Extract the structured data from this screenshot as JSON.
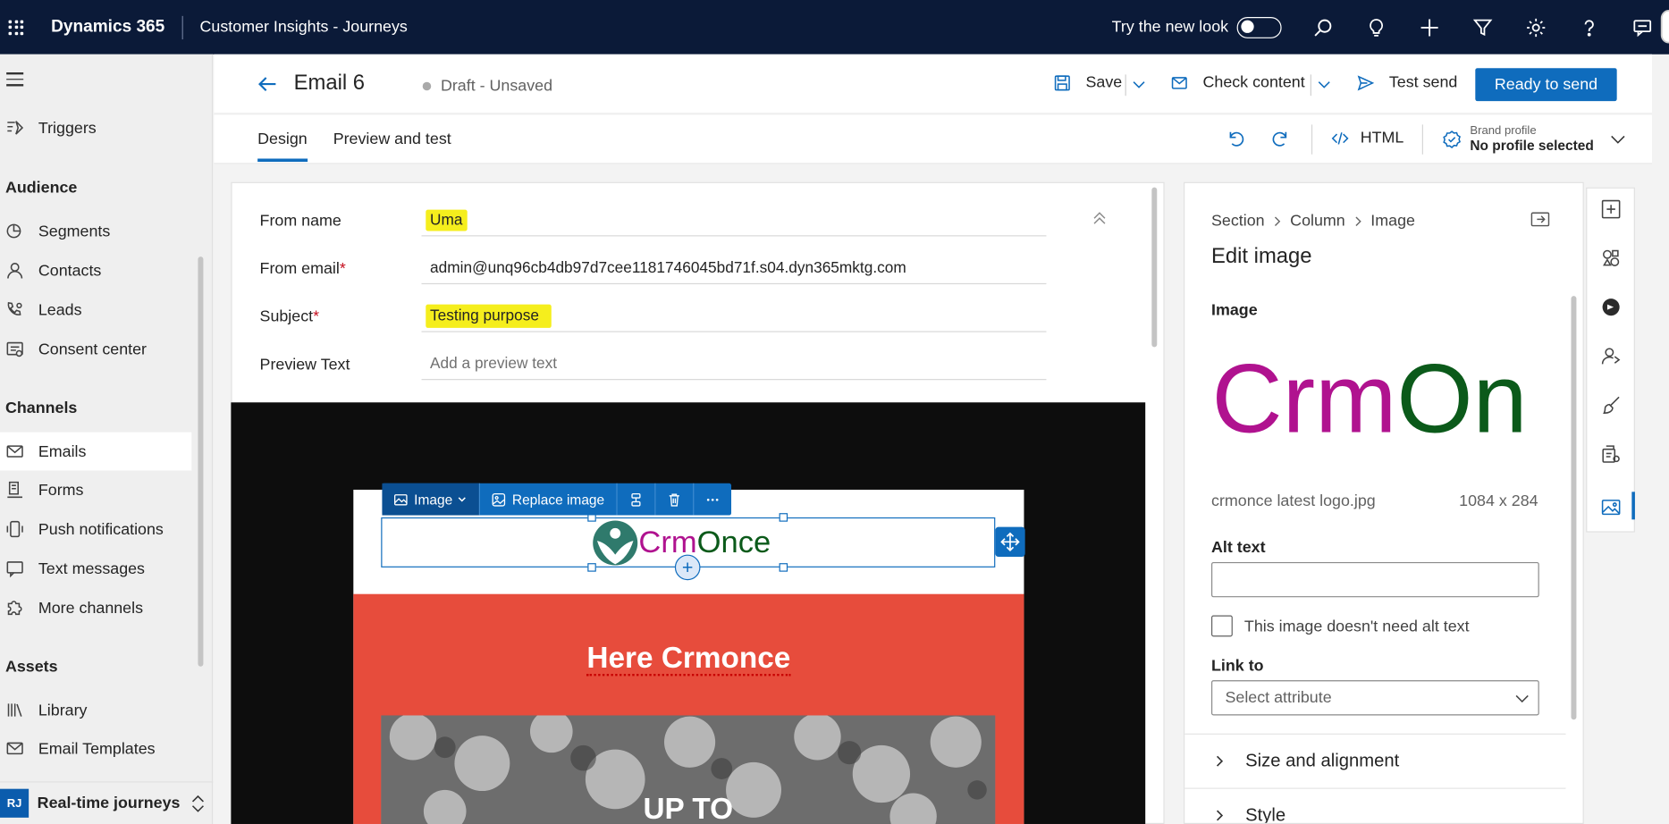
{
  "topbar": {
    "brand": "Dynamics 365",
    "app_name": "Customer Insights - Journeys",
    "try_new_look": "Try the new look",
    "icons": [
      "search-icon",
      "lightbulb-icon",
      "plus-icon",
      "filter-icon",
      "gear-icon",
      "help-icon",
      "chat-icon"
    ]
  },
  "nav": {
    "items_top": [
      {
        "label": "Triggers",
        "icon": "trigger-icon"
      }
    ],
    "audience_header": "Audience",
    "audience": [
      {
        "label": "Segments",
        "icon": "segments-icon"
      },
      {
        "label": "Contacts",
        "icon": "person-icon"
      },
      {
        "label": "Leads",
        "icon": "phone-person-icon"
      },
      {
        "label": "Consent center",
        "icon": "consent-icon"
      }
    ],
    "channels_header": "Channels",
    "channels": [
      {
        "label": "Emails",
        "icon": "mail-icon",
        "selected": true
      },
      {
        "label": "Forms",
        "icon": "form-icon"
      },
      {
        "label": "Push notifications",
        "icon": "push-icon"
      },
      {
        "label": "Text messages",
        "icon": "sms-icon"
      },
      {
        "label": "More channels",
        "icon": "puzzle-icon"
      }
    ],
    "assets_header": "Assets",
    "assets": [
      {
        "label": "Library",
        "icon": "library-icon"
      },
      {
        "label": "Email Templates",
        "icon": "template-icon"
      }
    ],
    "area_badge": "RJ",
    "area_label": "Real-time journeys"
  },
  "command": {
    "title": "Email 6",
    "status": "Draft - Unsaved",
    "save": "Save",
    "check_content": "Check content",
    "test_send": "Test send",
    "ready": "Ready to send"
  },
  "tabs": {
    "design": "Design",
    "preview": "Preview and test",
    "html": "HTML",
    "brand_profile_label": "Brand profile",
    "brand_profile_value": "No profile selected"
  },
  "form": {
    "from_name_label": "From name",
    "from_name": "Uma",
    "from_email_label": "From email",
    "from_email": "admin@unq96cb4db97d7cee1181746045bd71f.s04.dyn365mktg.com",
    "subject_label": "Subject",
    "subject": "Testing purpose",
    "preview_label": "Preview Text",
    "preview_placeholder": "Add a preview text",
    "required_mark": "*"
  },
  "canvas": {
    "toolbar_image": "Image",
    "toolbar_replace": "Replace image",
    "logo_part1": "Crm",
    "logo_part2": "Once",
    "hero_title": "Here Crmonce",
    "hero_image_text": "UP TO"
  },
  "panel": {
    "crumb": [
      "Section",
      "Column",
      "Image"
    ],
    "title": "Edit image",
    "image_label": "Image",
    "preview_part1": "Crm",
    "preview_part2": "On",
    "file_name": "crmonce latest logo.jpg",
    "file_dims": "1084 x 284",
    "alt_label": "Alt text",
    "alt_value": "",
    "no_alt_label": "This image doesn't need alt text",
    "link_label": "Link to",
    "link_placeholder": "Select attribute",
    "size_section": "Size and alignment",
    "style_section": "Style"
  },
  "colors": {
    "topbar": "#0b1a38",
    "accent": "#0f6cbd",
    "hero": "#e74c3c",
    "highlight": "#f5ee1d",
    "logo_magenta": "#b0128f",
    "logo_green": "#0b5a1a"
  }
}
